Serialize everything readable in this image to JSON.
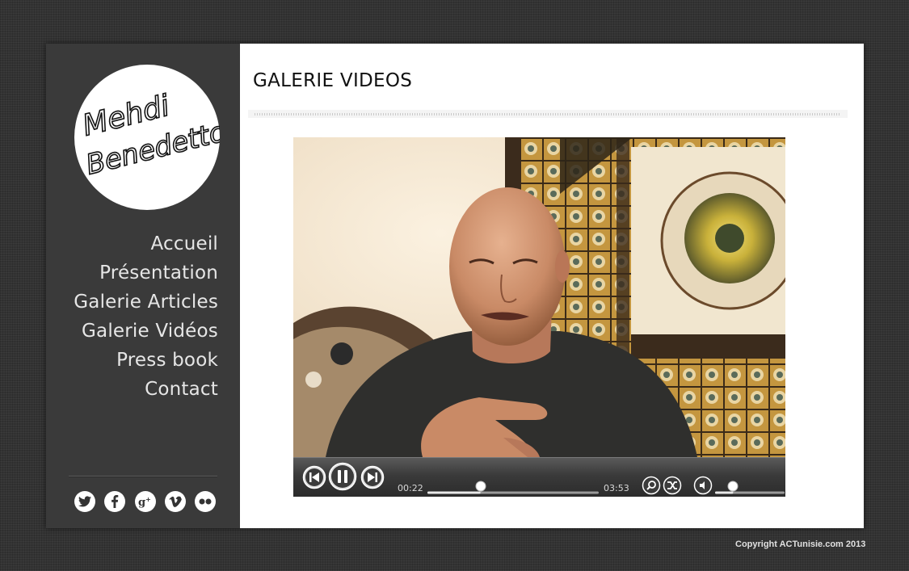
{
  "logo": {
    "line1": "Mehdi",
    "line2": "Benedetto"
  },
  "nav": {
    "items": [
      {
        "label": "Accueil"
      },
      {
        "label": "Présentation"
      },
      {
        "label": "Galerie Articles"
      },
      {
        "label": "Galerie Vidéos"
      },
      {
        "label": "Press book"
      },
      {
        "label": "Contact"
      }
    ]
  },
  "social": {
    "icons": [
      "twitter-icon",
      "facebook-icon",
      "google-plus-icon",
      "vimeo-icon",
      "flickr-icon"
    ]
  },
  "main": {
    "title": "GALERIE VIDEOS"
  },
  "player": {
    "current_time": "00:22",
    "duration": "03:53",
    "progress": 0.31,
    "volume": 0.26,
    "icons": [
      "previous-icon",
      "pause-icon",
      "next-icon",
      "zoom-icon",
      "shuffle-icon",
      "volume-icon"
    ]
  },
  "footer": {
    "copyright": "Copyright ACTunisie.com 2013"
  },
  "colors": {
    "sidebar": "#3a3a3a",
    "background": "#333333",
    "main": "#ffffff",
    "nav_text": "#e6e6e6"
  }
}
